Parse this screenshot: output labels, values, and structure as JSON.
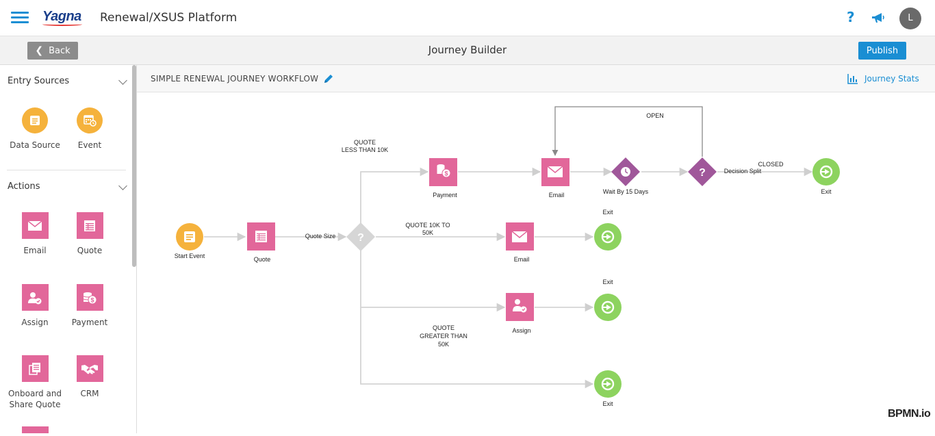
{
  "header": {
    "logo": "Yagna",
    "app_title": "Renewal/XSUS Platform",
    "help_icon": "question-mark-icon",
    "notifications_icon": "megaphone-icon",
    "avatar_initial": "L"
  },
  "subheader": {
    "back_label": "Back",
    "page_title": "Journey Builder",
    "publish_label": "Publish"
  },
  "sidebar": {
    "entry_sources": {
      "title": "Entry Sources",
      "items": [
        {
          "label": "Data Source",
          "icon": "document-icon"
        },
        {
          "label": "Event",
          "icon": "calendar-clock-icon"
        }
      ]
    },
    "actions": {
      "title": "Actions",
      "items": [
        {
          "label": "Email",
          "icon": "envelope-icon"
        },
        {
          "label": "Quote",
          "icon": "table-icon"
        },
        {
          "label": "Assign",
          "icon": "user-check-icon"
        },
        {
          "label": "Payment",
          "icon": "coins-dollar-icon"
        },
        {
          "label": "Onboard and Share Quote",
          "icon": "copy-document-icon"
        },
        {
          "label": "CRM",
          "icon": "handshake-icon"
        }
      ]
    }
  },
  "canvas_header": {
    "workflow_title": "SIMPLE RENEWAL JOURNEY WORKFLOW",
    "journey_stats_label": "Journey Stats"
  },
  "colors": {
    "accent_blue": "#1a8ed3",
    "entry_orange": "#f5b23c",
    "action_pink": "#e2679a",
    "wait_purple": "#a0579a",
    "exit_green": "#8dd35f",
    "gateway_gray": "#d6d6d6"
  },
  "workflow": {
    "nodes": {
      "start": {
        "label": "Start Event"
      },
      "quote": {
        "label": "Quote"
      },
      "quote_split": {
        "label": "Quote Size",
        "glyph": "?"
      },
      "payment": {
        "label": "Payment"
      },
      "email_top": {
        "label": "Email"
      },
      "wait": {
        "label": "Wait By 15 Days"
      },
      "decision": {
        "label": "Decision Split",
        "glyph": "?"
      },
      "exit_top": {
        "label": "Exit"
      },
      "email_mid": {
        "label": "Email"
      },
      "exit_mid": {
        "label": "Exit"
      },
      "assign": {
        "label": "Assign"
      },
      "exit_assign": {
        "label": "Exit"
      },
      "exit_bottom": {
        "label": "Exit"
      }
    },
    "edges": {
      "less_10k_line1": "QUOTE",
      "less_10k_line2": "LESS THAN 10K",
      "mid_line1": "QUOTE 10K TO",
      "mid_line2": "50K",
      "greater_line1": "QUOTE",
      "greater_line2": "GREATER THAN",
      "greater_line3": "50K",
      "open": "OPEN",
      "closed": "CLOSED"
    }
  },
  "watermark": "BPMN.io"
}
